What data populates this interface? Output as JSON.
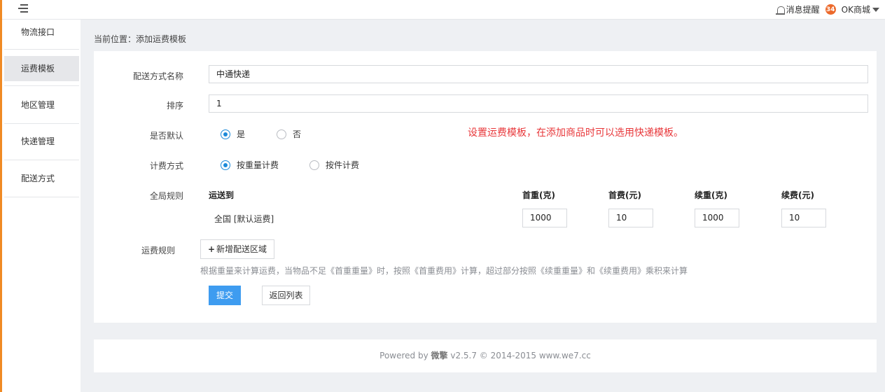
{
  "topbar": {
    "notify_label": "消息提醒",
    "badge_count": "34",
    "shop_name": "OK商城"
  },
  "sidebar": {
    "items": [
      {
        "label": "物流接口"
      },
      {
        "label": "运费模板",
        "active": true
      },
      {
        "label": "地区管理"
      },
      {
        "label": "快递管理"
      },
      {
        "label": "配送方式"
      }
    ]
  },
  "breadcrumb": "当前位置：添加运费模板",
  "form": {
    "name_label": "配送方式名称",
    "name_value": "中通快递",
    "sort_label": "排序",
    "sort_value": "1",
    "default_label": "是否默认",
    "default_options": [
      "是",
      "否"
    ],
    "default_selected": "是",
    "hint": "设置运费模板，在添加商品时可以选用快递模板。",
    "billing_label": "计费方式",
    "billing_options": [
      "按重量计费",
      "按件计费"
    ],
    "billing_selected": "按重量计费",
    "global_label": "全局规则",
    "table_headers": {
      "region": "运送到",
      "first_weight": "首重(克)",
      "first_fee": "首费(元)",
      "extra_weight": "续重(克)",
      "extra_fee": "续费(元)"
    },
    "global_row": {
      "region": "全国 [默认运费]",
      "first_weight": "1000",
      "first_fee": "10",
      "extra_weight": "1000",
      "extra_fee": "10"
    },
    "rules_label": "运费规则",
    "add_region_button": "新增配送区域",
    "help_text": "根据重量来计算运费，当物品不足《首重重量》时，按照《首重费用》计算，超过部分按照《续重重量》和《续重费用》乘积来计算",
    "submit_button": "提交",
    "back_button": "返回列表"
  },
  "footer": {
    "prefix": "Powered by ",
    "brand": "微擎",
    "suffix": " v2.5.7 © 2014-2015 www.we7.cc"
  },
  "colors": {
    "accent_orange": "#f08a24",
    "primary_blue": "#3e9cf0",
    "radio_blue": "#1c8ad9",
    "hint_red": "#e8373a",
    "badge_orange": "#ec6a2c"
  }
}
